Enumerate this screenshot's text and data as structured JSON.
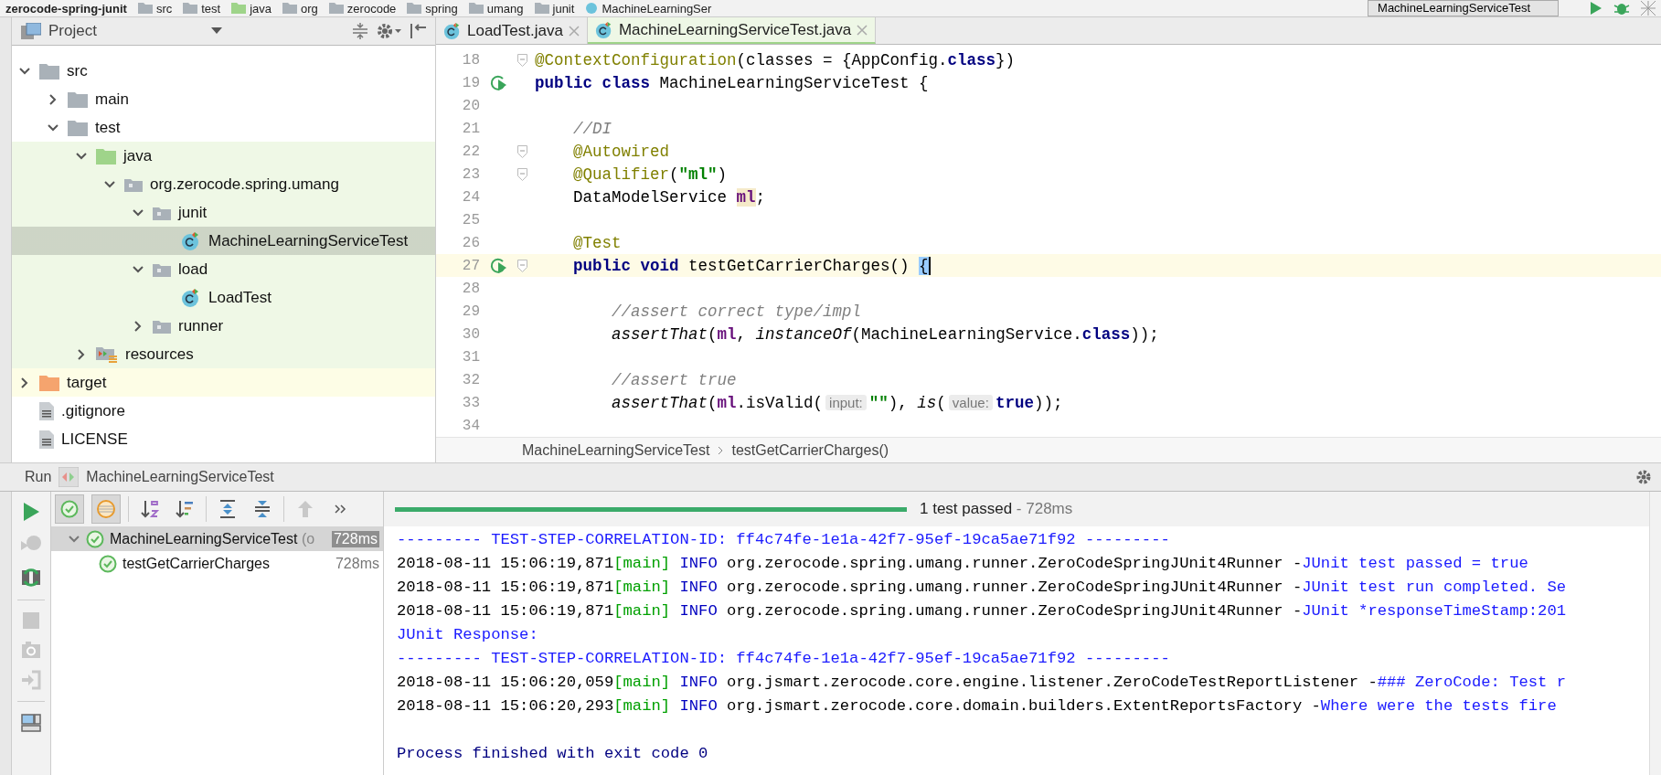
{
  "navigation_bar": {
    "items": [
      {
        "label": "zerocode-spring-junit",
        "kind": "project"
      },
      {
        "label": "src",
        "kind": "folder"
      },
      {
        "label": "test",
        "kind": "folder"
      },
      {
        "label": "java",
        "kind": "source"
      },
      {
        "label": "org",
        "kind": "folder"
      },
      {
        "label": "zerocode",
        "kind": "folder"
      },
      {
        "label": "spring",
        "kind": "folder"
      },
      {
        "label": "umang",
        "kind": "folder"
      },
      {
        "label": "junit",
        "kind": "folder"
      },
      {
        "label": "MachineLearningSer",
        "kind": "class"
      }
    ],
    "run_configuration": "MachineLearningServiceTest"
  },
  "project_panel": {
    "title": "Project",
    "tree": [
      {
        "label": "src",
        "kind": "folder",
        "test_scope": false,
        "excluded": false,
        "expanded": true,
        "selected": false,
        "children": [
          {
            "label": "main",
            "kind": "folder",
            "test_scope": false,
            "excluded": false,
            "expanded": false,
            "selected": false
          },
          {
            "label": "test",
            "kind": "folder",
            "test_scope": false,
            "excluded": false,
            "expanded": true,
            "selected": false,
            "children": [
              {
                "label": "java",
                "kind": "test_sources",
                "test_scope": true,
                "excluded": false,
                "expanded": true,
                "selected": false,
                "children": [
                  {
                    "label": "org.zerocode.spring.umang",
                    "kind": "package",
                    "test_scope": true,
                    "excluded": false,
                    "expanded": true,
                    "selected": false,
                    "children": [
                      {
                        "label": "junit",
                        "kind": "package",
                        "test_scope": true,
                        "excluded": false,
                        "expanded": true,
                        "selected": false,
                        "children": [
                          {
                            "label": "MachineLearningServiceTest",
                            "kind": "class",
                            "test_scope": true,
                            "excluded": false,
                            "selected": true
                          }
                        ]
                      },
                      {
                        "label": "load",
                        "kind": "package",
                        "test_scope": true,
                        "excluded": false,
                        "expanded": true,
                        "selected": false,
                        "children": [
                          {
                            "label": "LoadTest",
                            "kind": "class",
                            "test_scope": true,
                            "excluded": false,
                            "selected": false
                          }
                        ]
                      },
                      {
                        "label": "runner",
                        "kind": "package",
                        "test_scope": true,
                        "excluded": false,
                        "expanded": false,
                        "selected": false
                      }
                    ]
                  }
                ]
              },
              {
                "label": "resources",
                "kind": "test_resources",
                "test_scope": true,
                "excluded": false,
                "expanded": false,
                "selected": false
              }
            ]
          }
        ]
      },
      {
        "label": "target",
        "kind": "excluded",
        "test_scope": false,
        "excluded": true,
        "expanded": false,
        "selected": false
      },
      {
        "label": ".gitignore",
        "kind": "file",
        "test_scope": false,
        "excluded": false,
        "selected": false
      },
      {
        "label": "LICENSE",
        "kind": "file",
        "test_scope": false,
        "excluded": false,
        "selected": false
      }
    ]
  },
  "editor": {
    "tabs": [
      {
        "label": "LoadTest.java",
        "selected": false
      },
      {
        "label": "MachineLearningServiceTest.java",
        "selected": true
      }
    ],
    "lines": [
      {
        "number": "18",
        "run_marker": false,
        "fold_marker": true,
        "current": false,
        "tokens": [
          {
            "text": "@ContextConfiguration",
            "kind": "annotation"
          },
          {
            "text": "(classes = {AppConfig.",
            "kind": "plain"
          },
          {
            "text": "class",
            "kind": "keyword"
          },
          {
            "text": "})",
            "kind": "plain"
          }
        ]
      },
      {
        "number": "19",
        "run_marker": true,
        "fold_marker": false,
        "current": false,
        "tokens": [
          {
            "text": "public class ",
            "kind": "keyword"
          },
          {
            "text": "MachineLearningServiceTest {",
            "kind": "plain"
          }
        ]
      },
      {
        "number": "20",
        "run_marker": false,
        "fold_marker": false,
        "current": false
      },
      {
        "number": "21",
        "run_marker": false,
        "fold_marker": false,
        "current": false,
        "tokens": [
          {
            "text": "    //DI",
            "kind": "comment"
          }
        ]
      },
      {
        "number": "22",
        "run_marker": false,
        "fold_marker": true,
        "current": false,
        "tokens": [
          {
            "text": "    @Autowired",
            "kind": "annotation"
          }
        ]
      },
      {
        "number": "23",
        "run_marker": false,
        "fold_marker": true,
        "current": false,
        "tokens": [
          {
            "text": "    @Qualifier",
            "kind": "annotation"
          },
          {
            "text": "(",
            "kind": "plain"
          },
          {
            "text": "\"ml\"",
            "kind": "string"
          },
          {
            "text": ")",
            "kind": "plain"
          }
        ]
      },
      {
        "number": "24",
        "run_marker": false,
        "fold_marker": false,
        "current": false,
        "tokens": [
          {
            "text": "    DataModelService ",
            "kind": "plain"
          },
          {
            "text": "ml",
            "kind": "field_highlighted"
          },
          {
            "text": ";",
            "kind": "plain"
          }
        ]
      },
      {
        "number": "25",
        "run_marker": false,
        "fold_marker": false,
        "current": false
      },
      {
        "number": "26",
        "run_marker": false,
        "fold_marker": false,
        "current": false,
        "tokens": [
          {
            "text": "    @Test",
            "kind": "annotation"
          }
        ]
      },
      {
        "number": "27",
        "run_marker": true,
        "fold_marker": true,
        "current": true,
        "tokens": [
          {
            "text": "    public void ",
            "kind": "keyword"
          },
          {
            "text": "testGetCarrierCharges() ",
            "kind": "plain"
          },
          {
            "text": "{",
            "kind": "brace_match"
          }
        ]
      },
      {
        "number": "28",
        "run_marker": false,
        "fold_marker": false,
        "current": false
      },
      {
        "number": "29",
        "run_marker": false,
        "fold_marker": false,
        "current": false,
        "tokens": [
          {
            "text": "        //assert correct type/impl",
            "kind": "comment"
          }
        ]
      },
      {
        "number": "30",
        "run_marker": false,
        "fold_marker": false,
        "current": false,
        "tokens": [
          {
            "text": "        assertThat",
            "kind": "static"
          },
          {
            "text": "(",
            "kind": "plain"
          },
          {
            "text": "ml",
            "kind": "field"
          },
          {
            "text": ", ",
            "kind": "plain"
          },
          {
            "text": "instanceOf",
            "kind": "static"
          },
          {
            "text": "(MachineLearningService.",
            "kind": "plain"
          },
          {
            "text": "class",
            "kind": "keyword"
          },
          {
            "text": "));",
            "kind": "plain"
          }
        ]
      },
      {
        "number": "31",
        "run_marker": false,
        "fold_marker": false,
        "current": false
      },
      {
        "number": "32",
        "run_marker": false,
        "fold_marker": false,
        "current": false,
        "tokens": [
          {
            "text": "        //assert true",
            "kind": "comment"
          }
        ]
      },
      {
        "number": "33",
        "run_marker": false,
        "fold_marker": false,
        "current": false,
        "tokens": [
          {
            "text": "        assertThat",
            "kind": "static"
          },
          {
            "text": "(",
            "kind": "plain"
          },
          {
            "text": "ml",
            "kind": "field"
          },
          {
            "text": ".isValid(",
            "kind": "plain"
          },
          {
            "text": "input:",
            "kind": "hint"
          },
          {
            "text": "\"\"",
            "kind": "string"
          },
          {
            "text": "), ",
            "kind": "plain"
          },
          {
            "text": "is",
            "kind": "static"
          },
          {
            "text": "(",
            "kind": "plain"
          },
          {
            "text": "value:",
            "kind": "hint"
          },
          {
            "text": "true",
            "kind": "keyword"
          },
          {
            "text": "));",
            "kind": "plain"
          }
        ]
      },
      {
        "number": "34",
        "run_marker": false,
        "fold_marker": false,
        "current": false
      }
    ],
    "breadcrumbs": [
      "MachineLearningServiceTest",
      "testGetCarrierCharges()"
    ]
  },
  "run_panel": {
    "label": "Run",
    "configuration": "MachineLearningServiceTest",
    "toolbar": [
      {
        "kind": "show_passed",
        "selected": true
      },
      {
        "kind": "show_ignored",
        "selected": true
      },
      {
        "kind": "sort_alpha",
        "selected": false
      },
      {
        "kind": "sort_duration",
        "selected": false
      },
      {
        "kind": "expand_all",
        "selected": false
      },
      {
        "kind": "collapse_all",
        "selected": false
      },
      {
        "kind": "previous",
        "selected": false
      },
      {
        "kind": "more",
        "selected": false
      }
    ],
    "side_tools": [
      {
        "kind": "rerun",
        "disabled": false
      },
      {
        "kind": "rerun_failed",
        "disabled": true
      },
      {
        "kind": "auto_test",
        "disabled": false
      },
      {
        "kind": "stop",
        "disabled": true
      },
      {
        "kind": "snapshot",
        "disabled": true
      },
      {
        "kind": "import",
        "disabled": true
      },
      {
        "kind": "layout",
        "disabled": false
      }
    ],
    "progress": {
      "level": 1,
      "status": "1 test passed",
      "duration": "- 728ms"
    },
    "tests": [
      {
        "name": "MachineLearningServiceTest",
        "suffix": "(o",
        "duration": "728ms",
        "passed": true,
        "selected": true,
        "children": [
          {
            "name": "testGetCarrierCharges",
            "duration": "728ms",
            "passed": true,
            "selected": false
          }
        ]
      }
    ],
    "console": [
      {
        "kind": "text",
        "text": "--------- TEST-STEP-CORRELATION-ID: ff4c74fe-1e1a-42f7-95ef-19ca5ae71f92 ---------"
      },
      {
        "kind": "log",
        "timestamp": "2018-08-11 15:06:19,871",
        "thread": "[main]",
        "level": "INFO",
        "logger": "org.zerocode.spring.umang.runner.ZeroCodeSpringJUnit4Runner -",
        "message": "JUnit test passed = true"
      },
      {
        "kind": "log",
        "timestamp": "2018-08-11 15:06:19,871",
        "thread": "[main]",
        "level": "INFO",
        "logger": "org.zerocode.spring.umang.runner.ZeroCodeSpringJUnit4Runner -",
        "message": "JUnit test run completed. Se"
      },
      {
        "kind": "log",
        "timestamp": "2018-08-11 15:06:19,871",
        "thread": "[main]",
        "level": "INFO",
        "logger": "org.zerocode.spring.umang.runner.ZeroCodeSpringJUnit4Runner -",
        "message": "JUnit *responseTimeStamp:201"
      },
      {
        "kind": "text",
        "text": "JUnit Response:"
      },
      {
        "kind": "text",
        "text": "--------- TEST-STEP-CORRELATION-ID: ff4c74fe-1e1a-42f7-95ef-19ca5ae71f92 ---------"
      },
      {
        "kind": "log",
        "timestamp": "2018-08-11 15:06:20,059",
        "thread": "[main]",
        "level": "INFO",
        "logger": "org.jsmart.zerocode.core.engine.listener.ZeroCodeTestReportListener -",
        "message": "### ZeroCode: Test r"
      },
      {
        "kind": "log",
        "timestamp": "2018-08-11 15:06:20,293",
        "thread": "[main]",
        "level": "INFO",
        "logger": "org.jsmart.zerocode.core.domain.builders.ExtentReportsFactory -",
        "message": "Where were the tests fire"
      },
      {
        "kind": "blank"
      },
      {
        "kind": "exit",
        "text": "Process finished with exit code 0"
      }
    ]
  }
}
